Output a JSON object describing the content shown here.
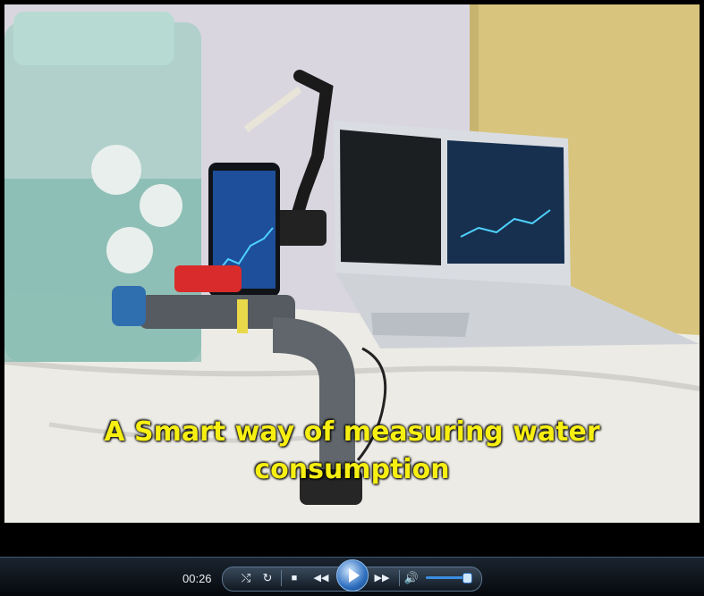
{
  "video": {
    "caption_line1": "A Smart way of measuring water",
    "caption_line2": "consumption"
  },
  "player": {
    "current_time": "00:26",
    "shuffle_icon": "shuffle-icon",
    "repeat_icon": "repeat-icon",
    "stop_icon": "stop-icon",
    "previous_icon": "previous-icon",
    "play_icon": "play-icon",
    "next_icon": "next-icon",
    "volume_icon": "volume-icon",
    "volume_level": 0.85,
    "accent_color": "#3b8fe0"
  }
}
